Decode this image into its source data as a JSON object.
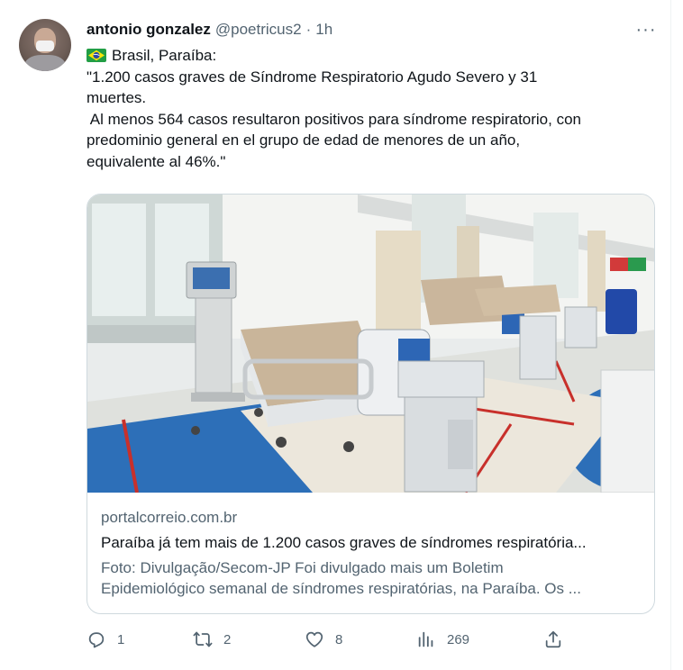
{
  "tweet": {
    "author_name": "antonio gonzalez",
    "author_handle": "@poetricus2",
    "separator": "·",
    "time": "1h",
    "more_label": "···",
    "location_line": "Brasil, Paraíba:",
    "text_lines": [
      "\"1.200 casos graves de Síndrome Respiratorio Agudo Severo y 31",
      "muertes.",
      " Al menos 564 casos resultaron positivos para síndrome respiratorio, con",
      "predominio general en el grupo de edad de menores de un año,",
      "equivalente al 46%.\""
    ]
  },
  "card": {
    "domain": "portalcorreio.com.br",
    "title": "Paraíba já tem mais de 1.200 casos graves de síndromes respiratória...",
    "description_lines": [
      "Foto: Divulgação/Secom-JP Foi divulgado mais um Boletim",
      "Epidemiológico semanal de síndromes respiratórias, na Paraíba. Os ..."
    ]
  },
  "actions": {
    "reply_count": "1",
    "retweet_count": "2",
    "like_count": "8",
    "views_count": "269"
  },
  "icons": {
    "reply": "reply-icon",
    "retweet": "retweet-icon",
    "like": "heart-icon",
    "views": "views-icon",
    "share": "share-icon",
    "more": "more-icon",
    "flag": "brazil-flag-icon"
  },
  "colors": {
    "text_primary": "#0f1419",
    "text_secondary": "#536471",
    "card_border": "#cfd9de"
  }
}
